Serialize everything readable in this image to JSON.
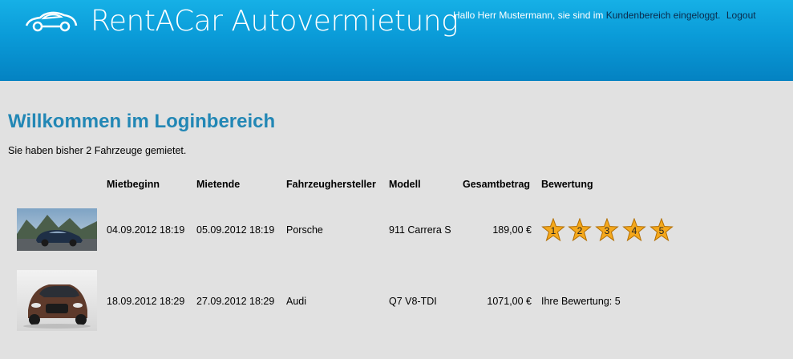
{
  "header": {
    "app_title": "RentACar Autovermietung",
    "greeting_prefix": "Hallo Herr Mustermann, sie sind im ",
    "greeting_link": "Kundenbereich",
    "greeting_suffix": " eingeloggt.",
    "logout_label": "Logout"
  },
  "main": {
    "title": "Willkommen im Loginbereich",
    "summary": "Sie haben bisher 2 Fahrzeuge gemietet."
  },
  "table": {
    "columns": [
      "Mietbeginn",
      "Mietende",
      "Fahrzeughersteller",
      "Modell",
      "Gesamtbetrag",
      "Bewertung"
    ],
    "rows": [
      {
        "start": "04.09.2012 18:19",
        "end": "05.09.2012 18:19",
        "manufacturer": "Porsche",
        "model": "911 Carrera S",
        "total": "189,00 €",
        "stars": [
          "1",
          "2",
          "3",
          "4",
          "5"
        ]
      },
      {
        "start": "18.09.2012 18:29",
        "end": "27.09.2012 18:29",
        "manufacturer": "Audi",
        "model": "Q7 V8-TDI",
        "total": "1071,00 €",
        "rating_text": "Ihre Bewertung: 5"
      }
    ]
  },
  "colors": {
    "header_top": "#16b0e6",
    "header_bottom": "#0482c2",
    "title": "#2287b5",
    "background": "#e1e1e1",
    "star_fill": "#f4a81c"
  }
}
